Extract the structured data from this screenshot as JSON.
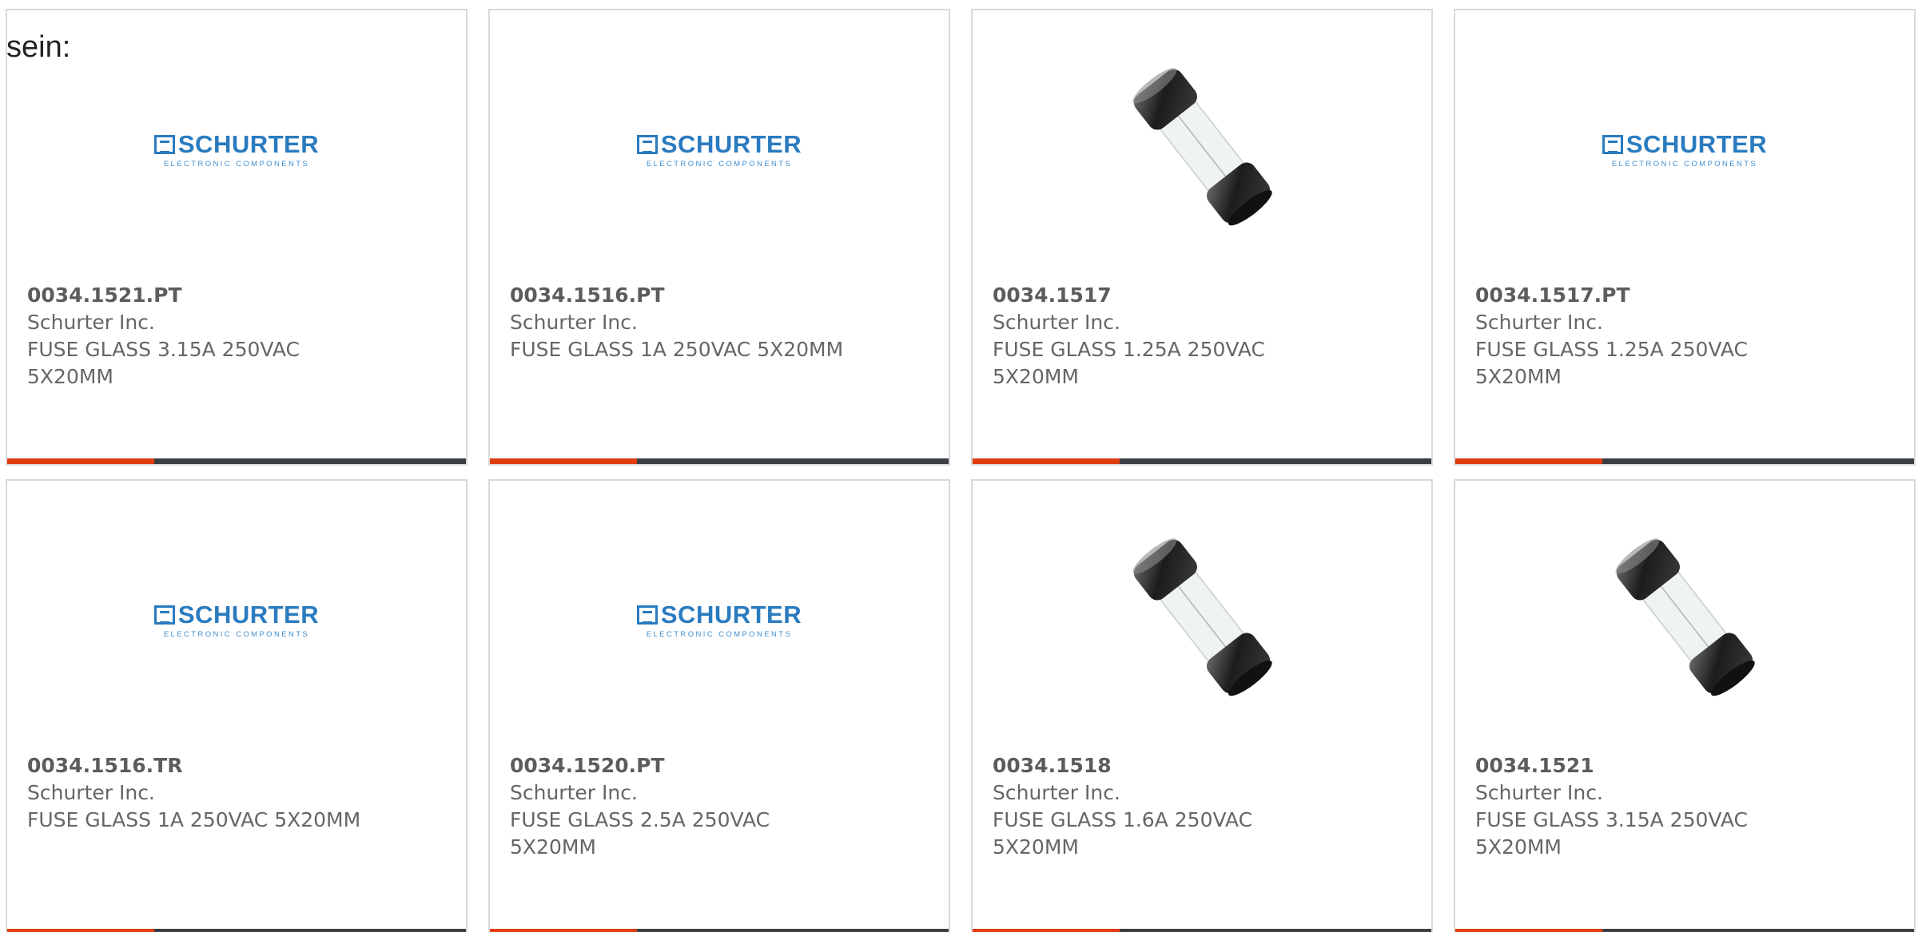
{
  "prefix_text": "sein:",
  "colors": {
    "card_bar_accent": "#e03c12",
    "card_bar_dark": "#3b3e43",
    "logo_blue": "#2a7bbf"
  },
  "cards": [
    {
      "image": "schurter-logo",
      "logo_word": "SCHURTER",
      "logo_sub": "ELECTRONIC COMPONENTS",
      "part_number": "0034.1521.PT",
      "manufacturer": "Schurter Inc.",
      "description": "FUSE GLASS 3.15A 250VAC 5X20MM"
    },
    {
      "image": "schurter-logo",
      "logo_word": "SCHURTER",
      "logo_sub": "ELECTRONIC COMPONENTS",
      "part_number": "0034.1516.PT",
      "manufacturer": "Schurter Inc.",
      "description": "FUSE GLASS 1A 250VAC 5X20MM"
    },
    {
      "image": "glass-fuse-photo",
      "part_number": "0034.1517",
      "manufacturer": "Schurter Inc.",
      "description": "FUSE GLASS 1.25A 250VAC 5X20MM"
    },
    {
      "image": "schurter-logo",
      "logo_word": "SCHURTER",
      "logo_sub": "ELECTRONIC COMPONENTS",
      "part_number": "0034.1517.PT",
      "manufacturer": "Schurter Inc.",
      "description": "FUSE GLASS 1.25A 250VAC 5X20MM"
    },
    {
      "image": "schurter-logo",
      "logo_word": "SCHURTER",
      "logo_sub": "ELECTRONIC COMPONENTS",
      "part_number": "0034.1516.TR",
      "manufacturer": "Schurter Inc.",
      "description": "FUSE GLASS 1A 250VAC 5X20MM"
    },
    {
      "image": "schurter-logo",
      "logo_word": "SCHURTER",
      "logo_sub": "ELECTRONIC COMPONENTS",
      "part_number": "0034.1520.PT",
      "manufacturer": "Schurter Inc.",
      "description": "FUSE GLASS 2.5A 250VAC 5X20MM"
    },
    {
      "image": "glass-fuse-photo",
      "part_number": "0034.1518",
      "manufacturer": "Schurter Inc.",
      "description": "FUSE GLASS 1.6A 250VAC 5X20MM"
    },
    {
      "image": "glass-fuse-photo",
      "part_number": "0034.1521",
      "manufacturer": "Schurter Inc.",
      "description": "FUSE GLASS 3.15A 250VAC 5X20MM"
    }
  ]
}
